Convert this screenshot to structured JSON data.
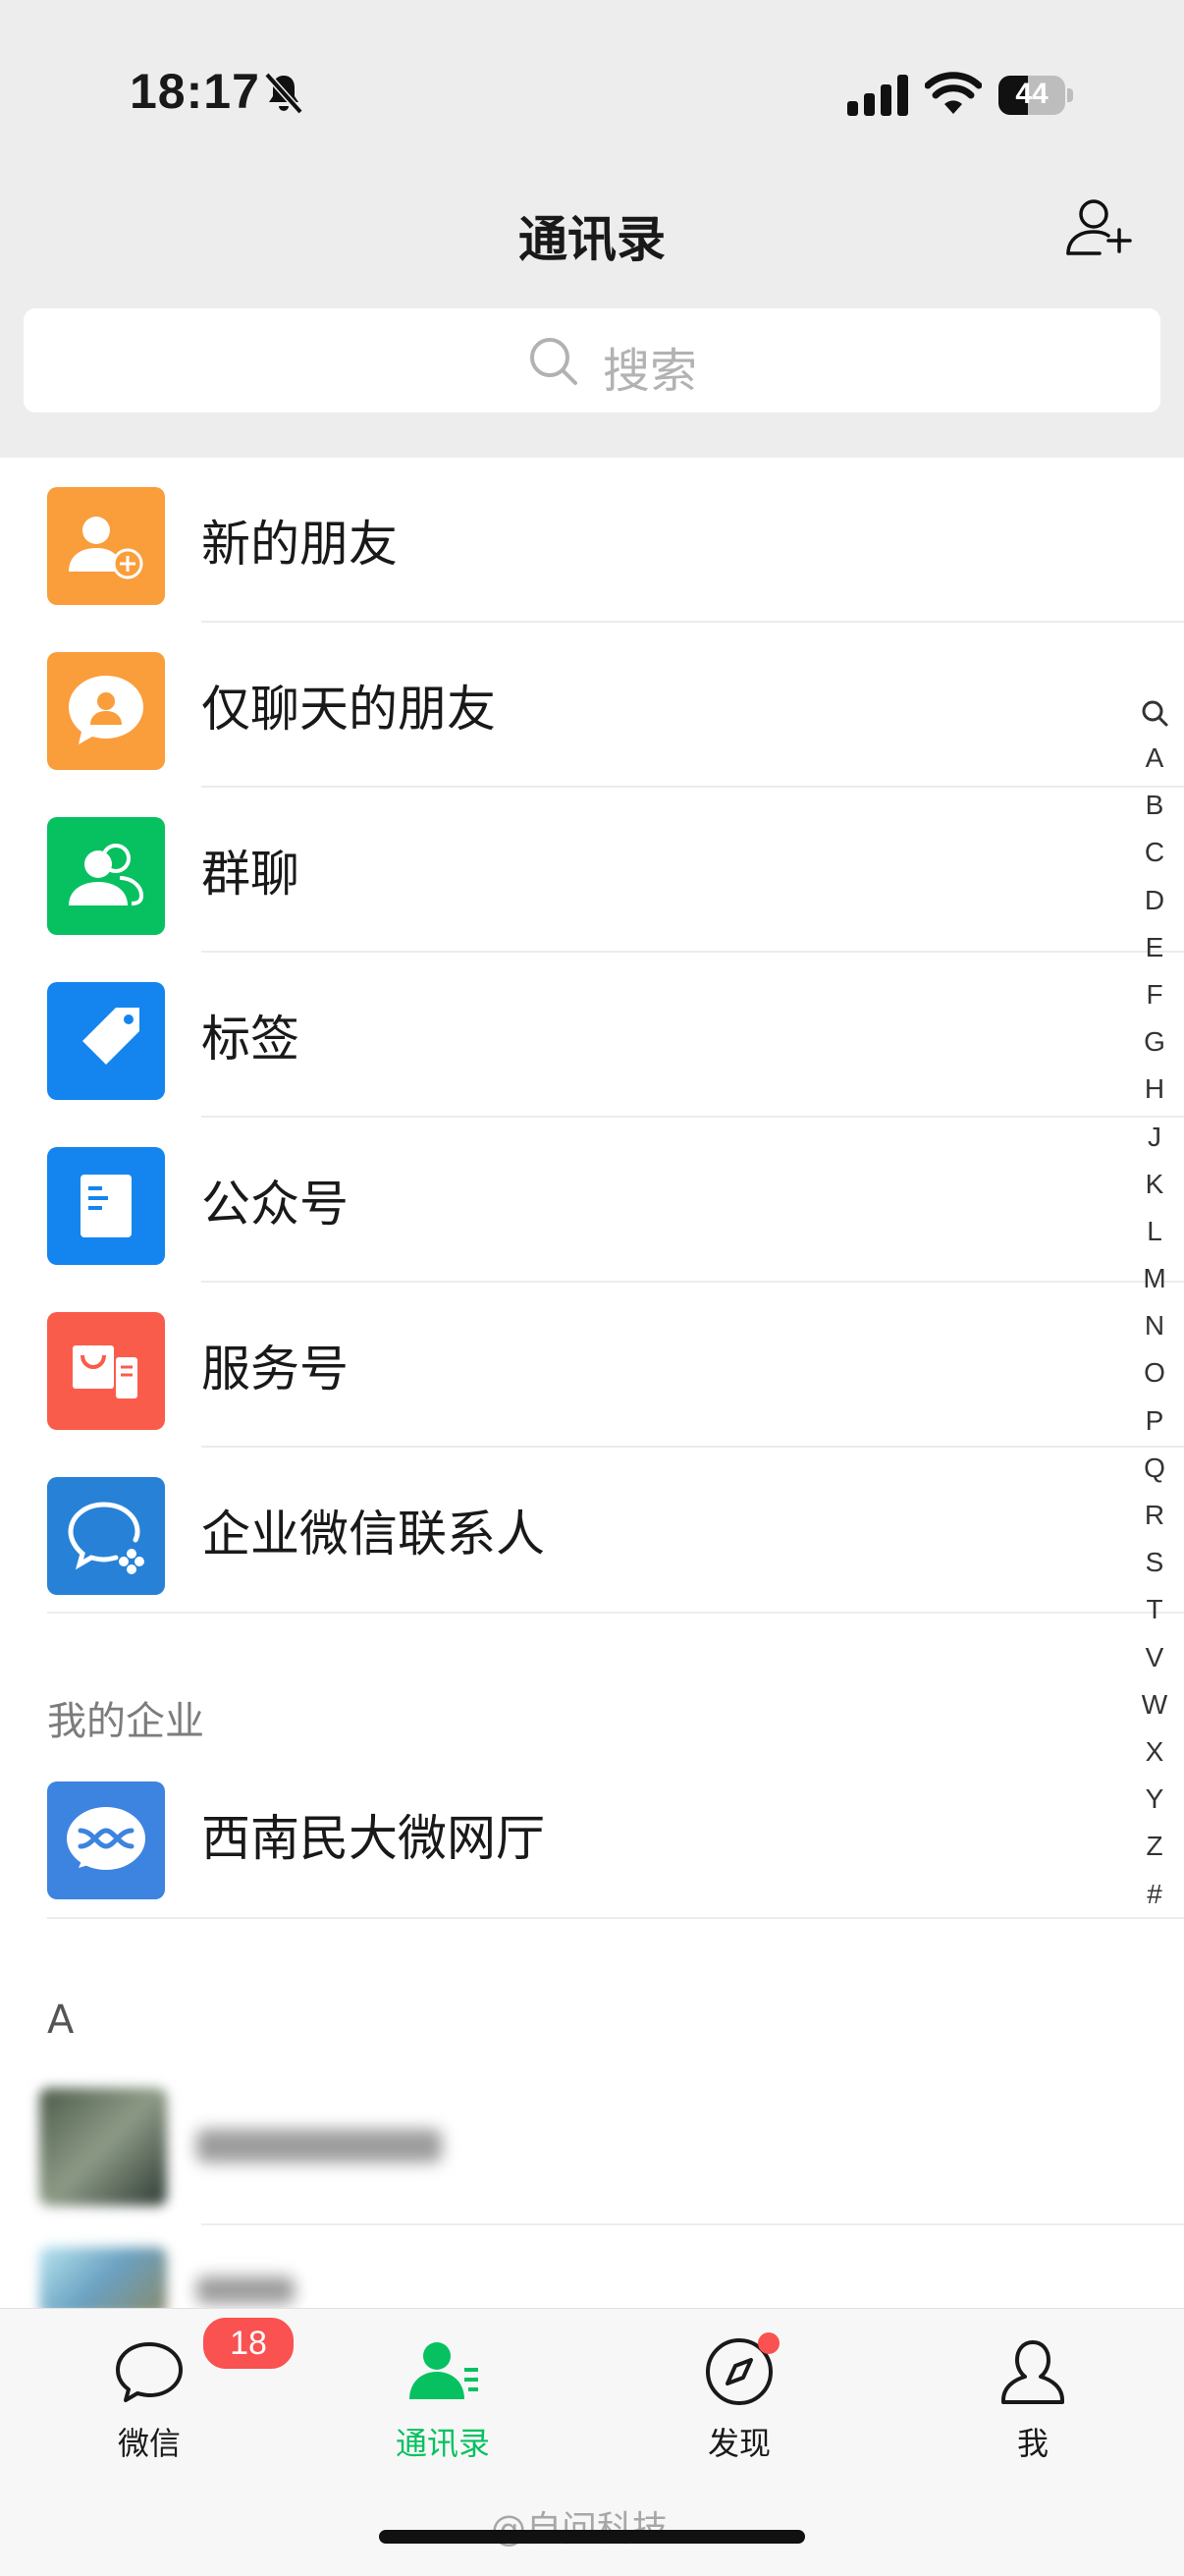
{
  "status": {
    "time": "18:17",
    "battery_text": "44",
    "battery_level": 0.44
  },
  "nav": {
    "title": "通讯录"
  },
  "search": {
    "placeholder": "搜索"
  },
  "menu_items": [
    {
      "label": "新的朋友",
      "icon": "new-friends-icon",
      "color": "#fa9d3b"
    },
    {
      "label": "仅聊天的朋友",
      "icon": "chat-only-friends-icon",
      "color": "#fa9d3b"
    },
    {
      "label": "群聊",
      "icon": "group-chat-icon",
      "color": "#07c160"
    },
    {
      "label": "标签",
      "icon": "tag-icon",
      "color": "#1485ee"
    },
    {
      "label": "公众号",
      "icon": "official-account-icon",
      "color": "#1485ee"
    },
    {
      "label": "服务号",
      "icon": "service-account-icon",
      "color": "#fa5c4b"
    },
    {
      "label": "企业微信联系人",
      "icon": "wecom-contacts-icon",
      "color": "#2782d7"
    }
  ],
  "enterprise": {
    "header": "我的企业",
    "items": [
      {
        "label": "西南民大微网厅",
        "icon": "enterprise-logo-icon",
        "color": "#3d83e0"
      }
    ]
  },
  "contacts_section": {
    "header": "A"
  },
  "index_letters": [
    "A",
    "B",
    "C",
    "D",
    "E",
    "F",
    "G",
    "H",
    "J",
    "K",
    "L",
    "M",
    "N",
    "O",
    "P",
    "Q",
    "R",
    "S",
    "T",
    "V",
    "W",
    "X",
    "Y",
    "Z",
    "#"
  ],
  "tabs": [
    {
      "label": "微信",
      "icon": "chat-bubble-icon",
      "badge": "18",
      "active": false
    },
    {
      "label": "通讯录",
      "icon": "contacts-icon",
      "active": true
    },
    {
      "label": "发现",
      "icon": "compass-icon",
      "dot": true,
      "active": false
    },
    {
      "label": "我",
      "icon": "person-icon",
      "active": false
    }
  ],
  "colors": {
    "accent": "#07c160",
    "badge": "#fa5151",
    "nav_bg": "#ededed"
  },
  "watermark": "@自问科技"
}
